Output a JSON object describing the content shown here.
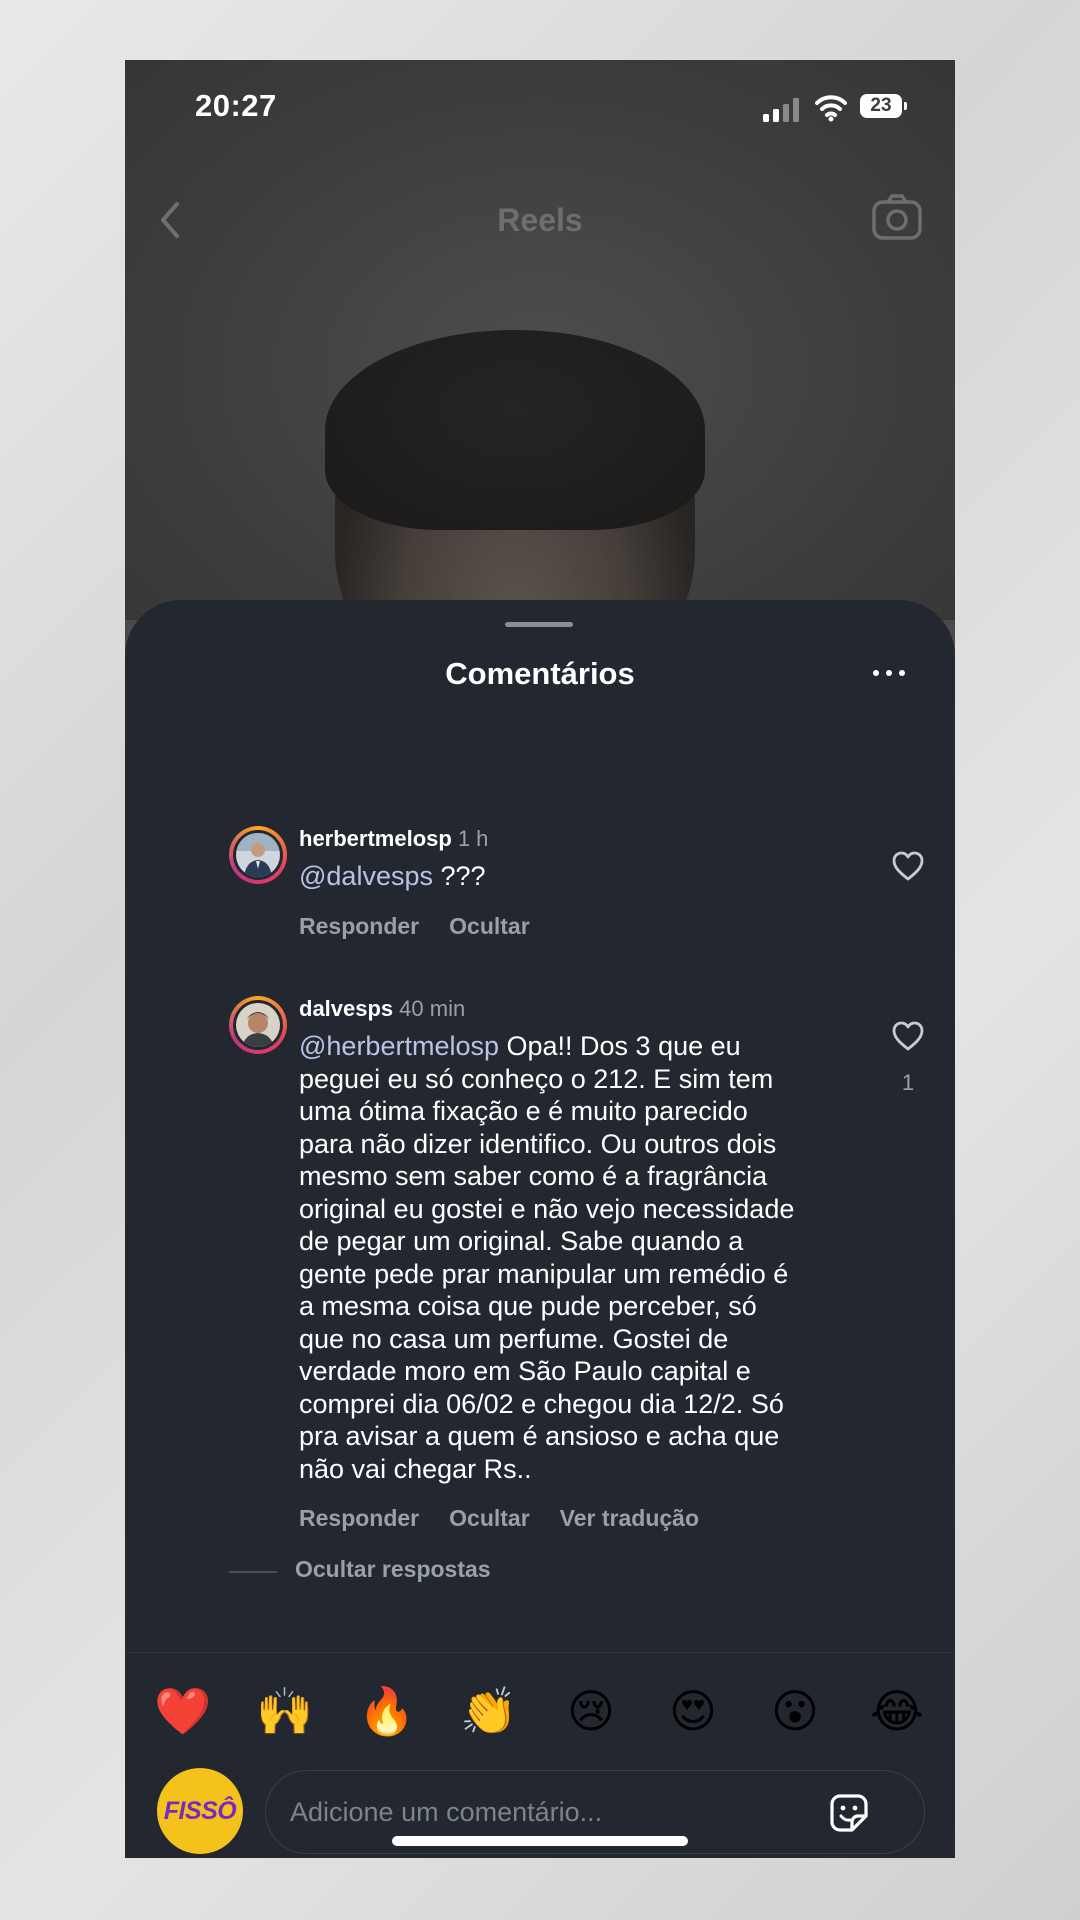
{
  "status_bar": {
    "time": "20:27",
    "battery": "23"
  },
  "top_nav": {
    "title": "Reels"
  },
  "sheet": {
    "title": "Comentários"
  },
  "comments": [
    {
      "username": "herbertmelosp",
      "time": "1 h",
      "mention": "@dalvesps",
      "text": " ???",
      "actions": {
        "reply": "Responder",
        "hide": "Ocultar"
      }
    },
    {
      "username": "dalvesps",
      "time": "40 min",
      "mention": "@herbertmelosp",
      "text": " Opa!! Dos 3 que eu\npeguei eu só conheço o 212. E sim tem\numa ótima fixação e é  muito parecido\npara não dizer identifico. Ou outros dois\nmesmo sem saber como é a fragrância\noriginal eu gostei e não vejo necessidade\nde pegar um original. Sabe quando a\ngente pede prar manipular um remédio é\na mesma coisa que pude perceber, só\nque no casa um perfume.  Gostei de\nverdade moro em São Paulo capital e\ncomprei dia 06/02 e chegou dia 12/2. Só\npra avisar a quem é ansioso e acha que\nnão vai chegar Rs..",
      "like_count": "1",
      "actions": {
        "reply": "Responder",
        "hide": "Ocultar",
        "translate": "Ver tradução"
      }
    }
  ],
  "hide_replies_label": "Ocultar respostas",
  "quick_reactions": [
    "❤️",
    "🙌",
    "🔥",
    "👏",
    "😢",
    "😍",
    "😮",
    "😂"
  ],
  "composer": {
    "avatar_text": "FISSÔ",
    "placeholder": "Adicione um comentário..."
  },
  "colors": {
    "sheet_background": "#232830",
    "mention": "#b8c4e6",
    "secondary_text": "#9aa0a8",
    "avatar_badge": "#f5c21b"
  },
  "icons": {
    "back": "chevron-left-icon",
    "camera": "camera-icon",
    "more": "more-horizontal-icon",
    "like": "heart-outline-icon",
    "sticker": "sticker-icon"
  }
}
